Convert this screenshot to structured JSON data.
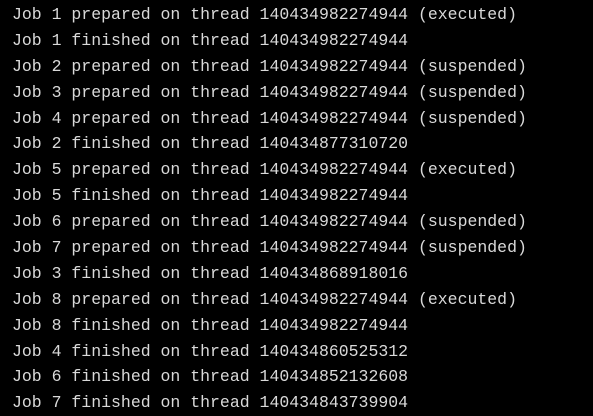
{
  "terminal": {
    "background": "#000000",
    "text_color": "#d9d9d9",
    "lines": [
      "Job 1 prepared on thread 140434982274944 (executed)",
      "Job 1 finished on thread 140434982274944",
      "Job 2 prepared on thread 140434982274944 (suspended)",
      "Job 3 prepared on thread 140434982274944 (suspended)",
      "Job 4 prepared on thread 140434982274944 (suspended)",
      "Job 2 finished on thread 140434877310720",
      "Job 5 prepared on thread 140434982274944 (executed)",
      "Job 5 finished on thread 140434982274944",
      "Job 6 prepared on thread 140434982274944 (suspended)",
      "Job 7 prepared on thread 140434982274944 (suspended)",
      "Job 3 finished on thread 140434868918016",
      "Job 8 prepared on thread 140434982274944 (executed)",
      "Job 8 finished on thread 140434982274944",
      "Job 4 finished on thread 140434860525312",
      "Job 6 finished on thread 140434852132608",
      "Job 7 finished on thread 140434843739904"
    ]
  }
}
